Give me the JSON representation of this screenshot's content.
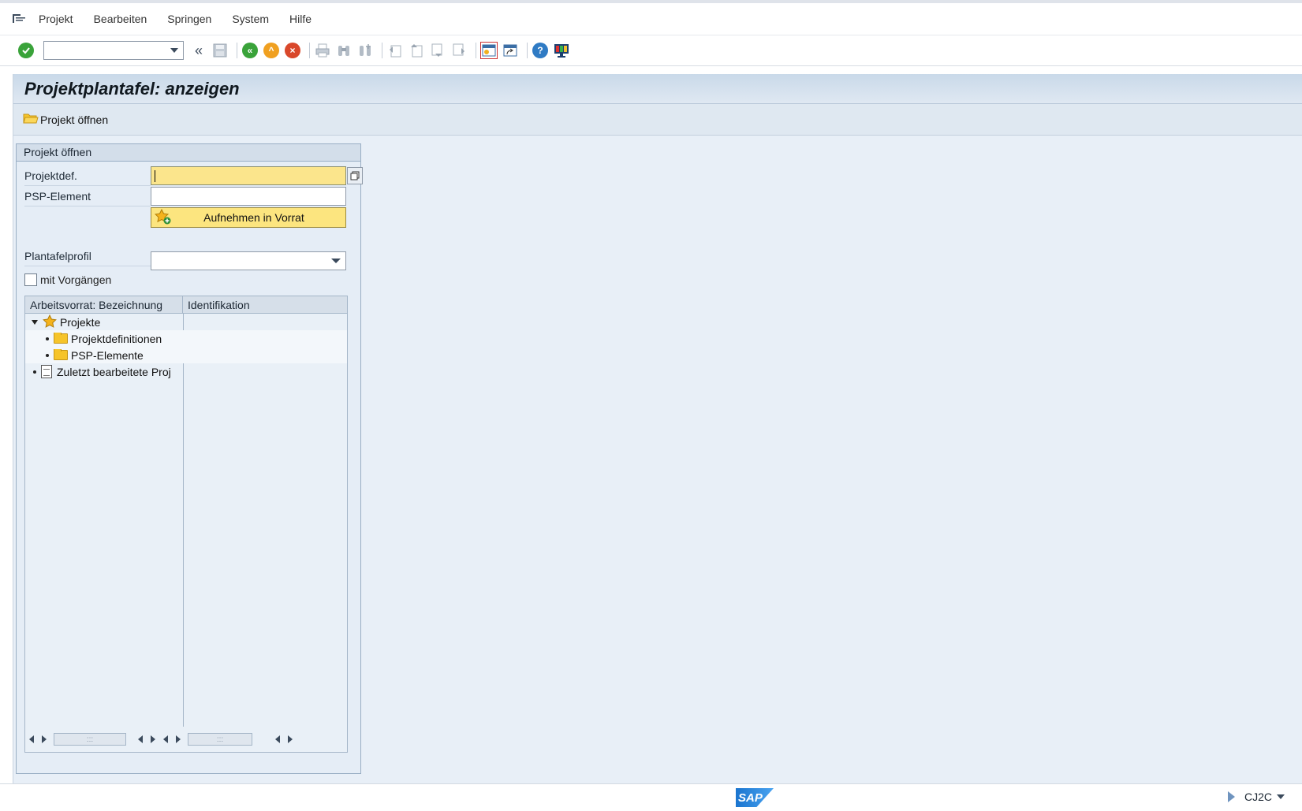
{
  "menubar": {
    "items": [
      {
        "label": "Projekt"
      },
      {
        "label": "Bearbeiten"
      },
      {
        "label": "Springen"
      },
      {
        "label": "System"
      },
      {
        "label": "Hilfe"
      }
    ]
  },
  "toolbar": {
    "command_value": "",
    "icons": [
      "enter-icon",
      "back-icon",
      "exit-icon",
      "cancel-icon",
      "save-icon",
      "print-icon",
      "find-icon",
      "find-next-icon",
      "first-page-icon",
      "previous-page-icon",
      "next-page-icon",
      "last-page-icon",
      "new-session-icon",
      "create-shortcut-icon",
      "help-icon",
      "customize-layout-icon"
    ]
  },
  "page": {
    "title": "Projektplantafel: anzeigen",
    "app_button_label": "Projekt öffnen"
  },
  "group": {
    "title": "Projekt öffnen",
    "projektdef_label": "Projektdef.",
    "projektdef_value": "",
    "psp_label": "PSP-Element",
    "psp_value": "",
    "add_button_label": "Aufnehmen in Vorrat",
    "profile_label": "Plantafelprofil",
    "profile_value": "",
    "checkbox_label": "mit Vorgängen",
    "checkbox_checked": false
  },
  "tree": {
    "columns": [
      "Arbeitsvorrat: Bezeichnung",
      "Identifikation"
    ],
    "rows": [
      {
        "label": "Projekte",
        "level": 0,
        "expanded": true,
        "icon": "star-icon"
      },
      {
        "label": "Projektdefinitionen",
        "level": 1,
        "icon": "folder-icon"
      },
      {
        "label": "PSP-Elemente",
        "level": 1,
        "icon": "folder-icon"
      },
      {
        "label": "Zuletzt bearbeitete Proj",
        "level": 0,
        "icon": "document-icon"
      }
    ]
  },
  "statusbar": {
    "logo_text": "SAP",
    "tcode": "CJ2C"
  }
}
